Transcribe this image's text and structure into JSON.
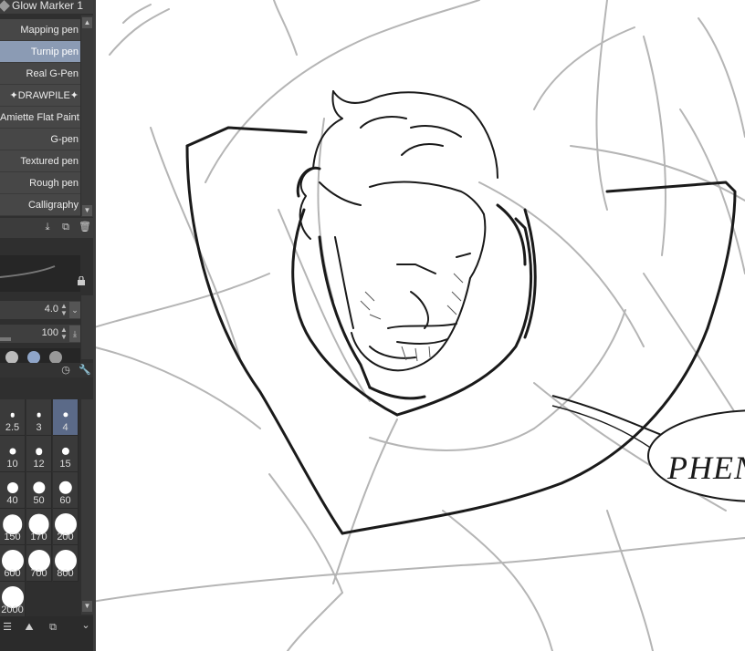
{
  "panel": {
    "title": "Glow Marker 1",
    "brushes": [
      {
        "label": "Mapping pen",
        "selected": false
      },
      {
        "label": "Turnip pen",
        "selected": true
      },
      {
        "label": "Real G-Pen",
        "selected": false
      },
      {
        "label": "✦DRAWPILE✦",
        "selected": false
      },
      {
        "label": "Amiette Flat Paint",
        "selected": false
      },
      {
        "label": "G-pen",
        "selected": false
      },
      {
        "label": "Textured pen",
        "selected": false
      },
      {
        "label": "Rough pen",
        "selected": false
      },
      {
        "label": "Calligraphy",
        "selected": false
      }
    ],
    "brush_size": "4.0",
    "opacity": "100",
    "sizes": [
      {
        "label": "2.5",
        "value": 2.5,
        "selected": false
      },
      {
        "label": "3",
        "value": 3,
        "selected": false
      },
      {
        "label": "4",
        "value": 4,
        "selected": true
      },
      {
        "label": "10",
        "value": 10,
        "selected": false
      },
      {
        "label": "12",
        "value": 12,
        "selected": false
      },
      {
        "label": "15",
        "value": 15,
        "selected": false
      },
      {
        "label": "40",
        "value": 40,
        "selected": false
      },
      {
        "label": "50",
        "value": 50,
        "selected": false
      },
      {
        "label": "60",
        "value": 60,
        "selected": false
      },
      {
        "label": "150",
        "value": 150,
        "selected": false
      },
      {
        "label": "170",
        "value": 170,
        "selected": false
      },
      {
        "label": "200",
        "value": 200,
        "selected": false
      },
      {
        "label": "600",
        "value": 600,
        "selected": false
      },
      {
        "label": "700",
        "value": 700,
        "selected": false
      },
      {
        "label": "800",
        "value": 800,
        "selected": false
      },
      {
        "label": "2000",
        "value": 2000,
        "selected": false
      }
    ]
  },
  "canvas": {
    "speech_text": "PHENU"
  },
  "colors": {
    "panel_bg": "#2f2f2f",
    "selected_item": "#8b9bb4",
    "selected_size": "#5b6a88",
    "sketch_lines": "#b5b5b5",
    "ink_lines": "#1a1a1a"
  }
}
